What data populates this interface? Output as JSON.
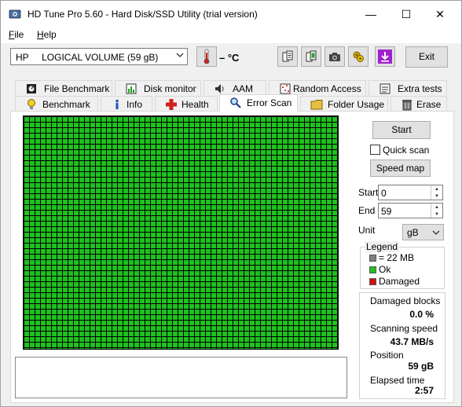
{
  "window": {
    "title": "HD Tune Pro 5.60 - Hard Disk/SSD Utility (trial version)",
    "minimize_glyph": "—",
    "maximize_glyph": "☐",
    "close_glyph": "✕"
  },
  "menu": {
    "file_first": "F",
    "file_rest": "ile",
    "help_first": "H",
    "help_rest": "elp"
  },
  "toolbar": {
    "drive": "HP     LOGICAL VOLUME (59 gB)",
    "temperature": "– °C",
    "exit_label": "Exit",
    "icons": [
      "copy-text-icon",
      "copy-info-icon",
      "camera-icon",
      "options-icon",
      "save-download-icon"
    ]
  },
  "tabs": {
    "top_row": [
      "File Benchmark",
      "Disk monitor",
      "AAM",
      "Random Access",
      "Extra tests"
    ],
    "bottom_row": [
      "Benchmark",
      "Info",
      "Health",
      "Error Scan",
      "Folder Usage",
      "Erase"
    ],
    "active": "Error Scan"
  },
  "controls": {
    "start_button": "Start",
    "quick_scan_label": "Quick scan",
    "quick_scan_checked": false,
    "speed_map_button": "Speed map",
    "start_label": "Start",
    "start_value": "0",
    "end_label": "End",
    "end_value": "59",
    "unit_label": "Unit",
    "unit_value": "gB"
  },
  "legend": {
    "title": "Legend",
    "block_size": "= 22 MB",
    "ok": "Ok",
    "damaged": "Damaged"
  },
  "stats": {
    "damaged_blocks_label": "Damaged blocks",
    "damaged_blocks_value": "0.0 %",
    "scanning_speed_label": "Scanning speed",
    "scanning_speed_value": "43.7 MB/s",
    "position_label": "Position",
    "position_value": "59 gB",
    "elapsed_time_label": "Elapsed time",
    "elapsed_time_value": "2:57"
  },
  "colors": {
    "ok": "#20c020",
    "damaged": "#d01010",
    "unscanned": "#808080"
  }
}
